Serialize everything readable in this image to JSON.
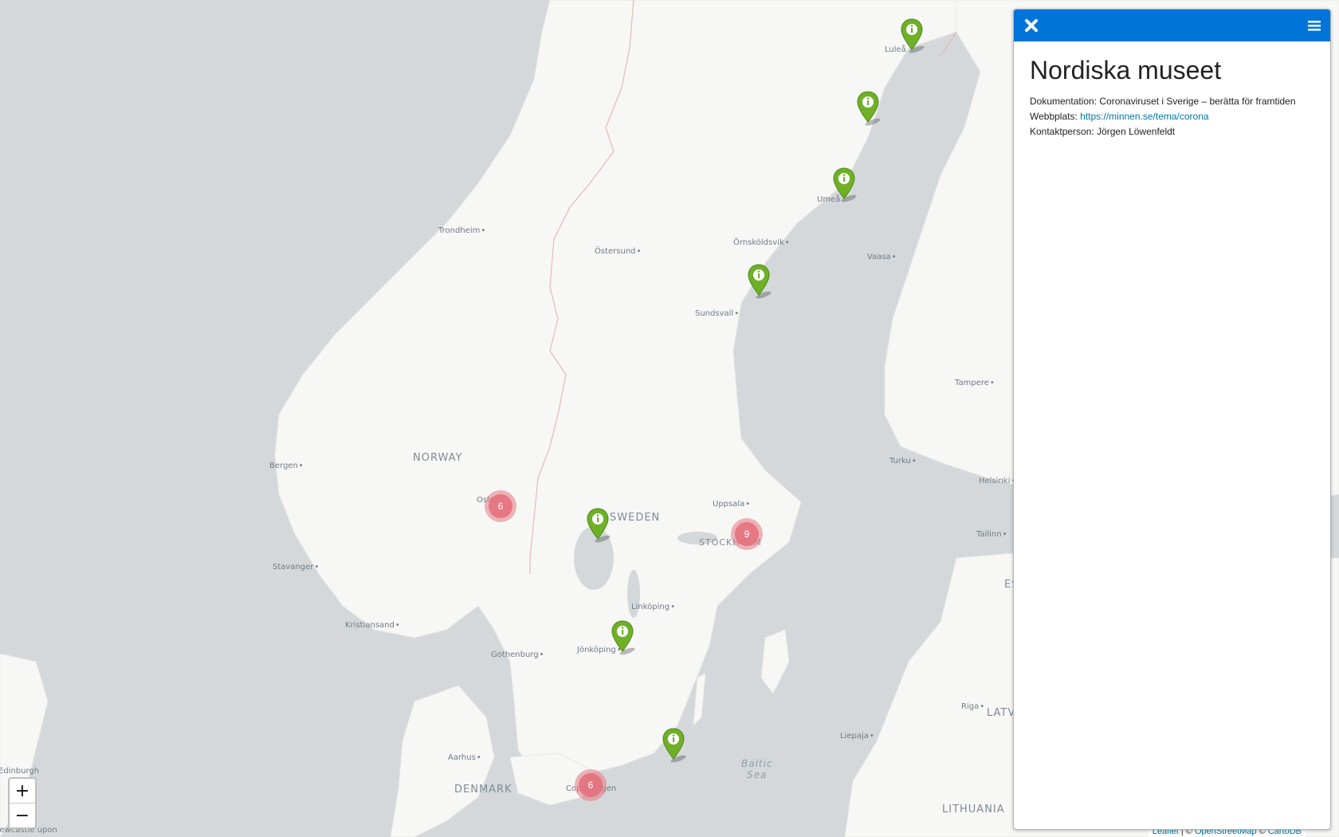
{
  "map": {
    "city_labels": [
      {
        "name": "Luleå"
      },
      {
        "name": "Umeå"
      },
      {
        "name": "Örnsköldsvik"
      },
      {
        "name": "Vaasa"
      },
      {
        "name": "Trondheim"
      },
      {
        "name": "Östersund"
      },
      {
        "name": "Sundsvall"
      },
      {
        "name": "Tampere"
      },
      {
        "name": "Bergen"
      },
      {
        "name": "Turku"
      },
      {
        "name": "Helsinki"
      },
      {
        "name": "Oslo"
      },
      {
        "name": "Uppsala"
      },
      {
        "name": "Tallinn"
      },
      {
        "name": "Stavanger"
      },
      {
        "name": "Linköping"
      },
      {
        "name": "Kristiansand"
      },
      {
        "name": "Gothenburg"
      },
      {
        "name": "Jönköping"
      },
      {
        "name": "Riga"
      },
      {
        "name": "Aarhus"
      },
      {
        "name": "Liepaja"
      },
      {
        "name": "Copenhagen"
      },
      {
        "name": "Edinburgh"
      },
      {
        "name": "Newcastle upon"
      }
    ],
    "country_labels": [
      {
        "name": "NORWAY"
      },
      {
        "name": "SWEDEN"
      },
      {
        "name": "STOCKHOLM"
      },
      {
        "name": "DENMARK"
      },
      {
        "name": "LATVIA"
      },
      {
        "name": "LITHUANIA"
      },
      {
        "name": "ESTONIA"
      }
    ],
    "sea_labels": [
      {
        "name": "Baltic\nSea"
      }
    ],
    "markers": [
      {
        "name": "marker-lulea",
        "icon": "info-icon"
      },
      {
        "name": "marker-skelleftea",
        "icon": "info-icon"
      },
      {
        "name": "marker-umea",
        "icon": "info-icon"
      },
      {
        "name": "marker-harnosand",
        "icon": "info-icon"
      },
      {
        "name": "marker-karlstad",
        "icon": "info-icon"
      },
      {
        "name": "marker-jonkoping",
        "icon": "info-icon"
      },
      {
        "name": "marker-karlskrona",
        "icon": "info-icon"
      }
    ],
    "clusters": [
      {
        "name": "cluster-oslo",
        "count": "6"
      },
      {
        "name": "cluster-stockholm",
        "count": "9"
      },
      {
        "name": "cluster-copenhagen",
        "count": "6"
      }
    ],
    "colors": {
      "water": "#d4d8da",
      "land": "#f7f7f6",
      "marker": "#6fb027",
      "cluster": "#e46e7a"
    }
  },
  "zoom": {
    "in_label": "+",
    "out_label": "−"
  },
  "attribution": {
    "leaflet": "Leaflet",
    "separator": " | © ",
    "osm": "OpenStreetMap",
    "separator2": " © ",
    "carto": "CartoDB"
  },
  "sidebar": {
    "header_color": "#0074d9",
    "close_icon": "close-icon",
    "menu_icon": "hamburger-icon",
    "title": "Nordiska museet",
    "doc_label": "Dokumentation: ",
    "doc_value": "Coronaviruset i Sverige – berätta för framtiden",
    "web_label": "Webbplats: ",
    "web_value": "https://minnen.se/tema/corona",
    "contact_label": "Kontaktperson: ",
    "contact_value": "Jörgen Löwenfeldt"
  }
}
